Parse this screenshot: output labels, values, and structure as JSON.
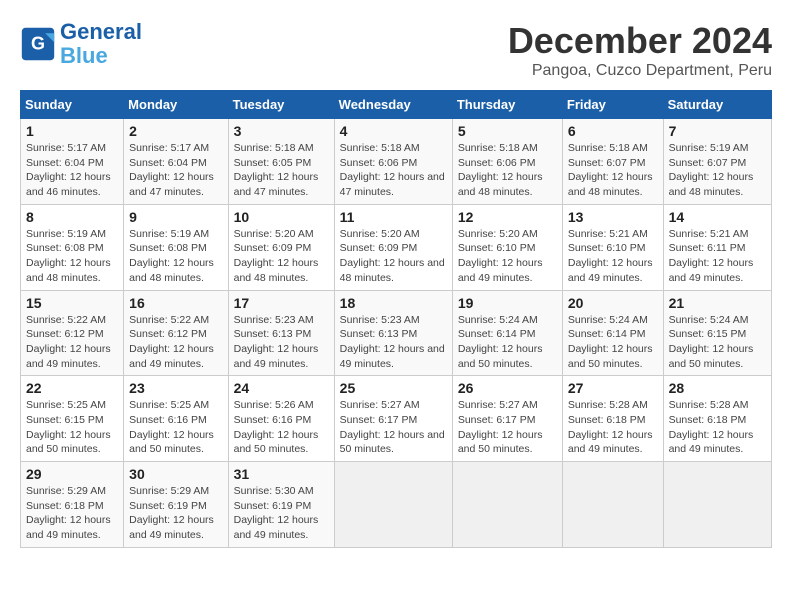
{
  "logo": {
    "line1": "General",
    "line2": "Blue"
  },
  "title": "December 2024",
  "subtitle": "Pangoa, Cuzco Department, Peru",
  "weekdays": [
    "Sunday",
    "Monday",
    "Tuesday",
    "Wednesday",
    "Thursday",
    "Friday",
    "Saturday"
  ],
  "weeks": [
    [
      {
        "day": "1",
        "sunrise": "5:17 AM",
        "sunset": "6:04 PM",
        "daylight": "12 hours and 46 minutes."
      },
      {
        "day": "2",
        "sunrise": "5:17 AM",
        "sunset": "6:04 PM",
        "daylight": "12 hours and 47 minutes."
      },
      {
        "day": "3",
        "sunrise": "5:18 AM",
        "sunset": "6:05 PM",
        "daylight": "12 hours and 47 minutes."
      },
      {
        "day": "4",
        "sunrise": "5:18 AM",
        "sunset": "6:06 PM",
        "daylight": "12 hours and 47 minutes."
      },
      {
        "day": "5",
        "sunrise": "5:18 AM",
        "sunset": "6:06 PM",
        "daylight": "12 hours and 48 minutes."
      },
      {
        "day": "6",
        "sunrise": "5:18 AM",
        "sunset": "6:07 PM",
        "daylight": "12 hours and 48 minutes."
      },
      {
        "day": "7",
        "sunrise": "5:19 AM",
        "sunset": "6:07 PM",
        "daylight": "12 hours and 48 minutes."
      }
    ],
    [
      {
        "day": "8",
        "sunrise": "5:19 AM",
        "sunset": "6:08 PM",
        "daylight": "12 hours and 48 minutes."
      },
      {
        "day": "9",
        "sunrise": "5:19 AM",
        "sunset": "6:08 PM",
        "daylight": "12 hours and 48 minutes."
      },
      {
        "day": "10",
        "sunrise": "5:20 AM",
        "sunset": "6:09 PM",
        "daylight": "12 hours and 48 minutes."
      },
      {
        "day": "11",
        "sunrise": "5:20 AM",
        "sunset": "6:09 PM",
        "daylight": "12 hours and 48 minutes."
      },
      {
        "day": "12",
        "sunrise": "5:20 AM",
        "sunset": "6:10 PM",
        "daylight": "12 hours and 49 minutes."
      },
      {
        "day": "13",
        "sunrise": "5:21 AM",
        "sunset": "6:10 PM",
        "daylight": "12 hours and 49 minutes."
      },
      {
        "day": "14",
        "sunrise": "5:21 AM",
        "sunset": "6:11 PM",
        "daylight": "12 hours and 49 minutes."
      }
    ],
    [
      {
        "day": "15",
        "sunrise": "5:22 AM",
        "sunset": "6:12 PM",
        "daylight": "12 hours and 49 minutes."
      },
      {
        "day": "16",
        "sunrise": "5:22 AM",
        "sunset": "6:12 PM",
        "daylight": "12 hours and 49 minutes."
      },
      {
        "day": "17",
        "sunrise": "5:23 AM",
        "sunset": "6:13 PM",
        "daylight": "12 hours and 49 minutes."
      },
      {
        "day": "18",
        "sunrise": "5:23 AM",
        "sunset": "6:13 PM",
        "daylight": "12 hours and 49 minutes."
      },
      {
        "day": "19",
        "sunrise": "5:24 AM",
        "sunset": "6:14 PM",
        "daylight": "12 hours and 50 minutes."
      },
      {
        "day": "20",
        "sunrise": "5:24 AM",
        "sunset": "6:14 PM",
        "daylight": "12 hours and 50 minutes."
      },
      {
        "day": "21",
        "sunrise": "5:24 AM",
        "sunset": "6:15 PM",
        "daylight": "12 hours and 50 minutes."
      }
    ],
    [
      {
        "day": "22",
        "sunrise": "5:25 AM",
        "sunset": "6:15 PM",
        "daylight": "12 hours and 50 minutes."
      },
      {
        "day": "23",
        "sunrise": "5:25 AM",
        "sunset": "6:16 PM",
        "daylight": "12 hours and 50 minutes."
      },
      {
        "day": "24",
        "sunrise": "5:26 AM",
        "sunset": "6:16 PM",
        "daylight": "12 hours and 50 minutes."
      },
      {
        "day": "25",
        "sunrise": "5:27 AM",
        "sunset": "6:17 PM",
        "daylight": "12 hours and 50 minutes."
      },
      {
        "day": "26",
        "sunrise": "5:27 AM",
        "sunset": "6:17 PM",
        "daylight": "12 hours and 50 minutes."
      },
      {
        "day": "27",
        "sunrise": "5:28 AM",
        "sunset": "6:18 PM",
        "daylight": "12 hours and 49 minutes."
      },
      {
        "day": "28",
        "sunrise": "5:28 AM",
        "sunset": "6:18 PM",
        "daylight": "12 hours and 49 minutes."
      }
    ],
    [
      {
        "day": "29",
        "sunrise": "5:29 AM",
        "sunset": "6:18 PM",
        "daylight": "12 hours and 49 minutes."
      },
      {
        "day": "30",
        "sunrise": "5:29 AM",
        "sunset": "6:19 PM",
        "daylight": "12 hours and 49 minutes."
      },
      {
        "day": "31",
        "sunrise": "5:30 AM",
        "sunset": "6:19 PM",
        "daylight": "12 hours and 49 minutes."
      },
      null,
      null,
      null,
      null
    ]
  ],
  "labels": {
    "sunrise": "Sunrise:",
    "sunset": "Sunset:",
    "daylight": "Daylight:"
  }
}
